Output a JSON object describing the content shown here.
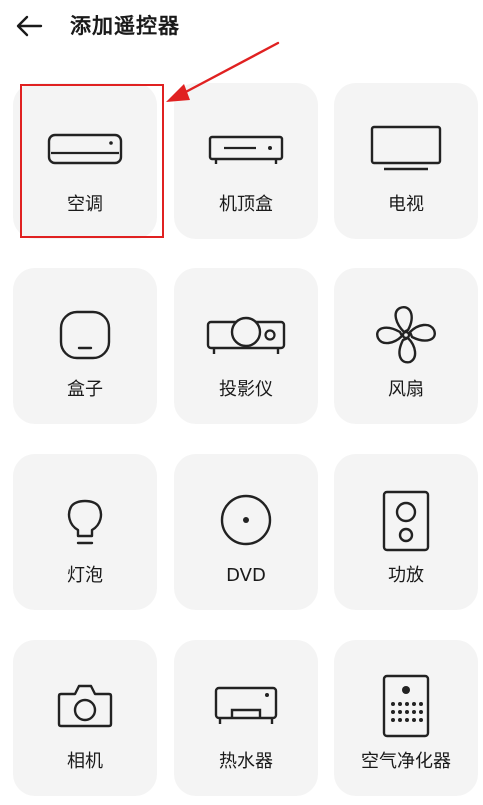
{
  "header": {
    "title": "添加遥控器"
  },
  "devices": [
    {
      "label": "空调",
      "icon": "air-conditioner-icon"
    },
    {
      "label": "机顶盒",
      "icon": "set-top-box-icon"
    },
    {
      "label": "电视",
      "icon": "tv-icon"
    },
    {
      "label": "盒子",
      "icon": "box-icon"
    },
    {
      "label": "投影仪",
      "icon": "projector-icon"
    },
    {
      "label": "风扇",
      "icon": "fan-icon"
    },
    {
      "label": "灯泡",
      "icon": "light-bulb-icon"
    },
    {
      "label": "DVD",
      "icon": "dvd-icon"
    },
    {
      "label": "功放",
      "icon": "speaker-icon"
    },
    {
      "label": "相机",
      "icon": "camera-icon"
    },
    {
      "label": "热水器",
      "icon": "water-heater-icon"
    },
    {
      "label": "空气净化器",
      "icon": "air-purifier-icon"
    }
  ],
  "annotation": {
    "color": "#e02121",
    "highlighted_item": "空调"
  }
}
